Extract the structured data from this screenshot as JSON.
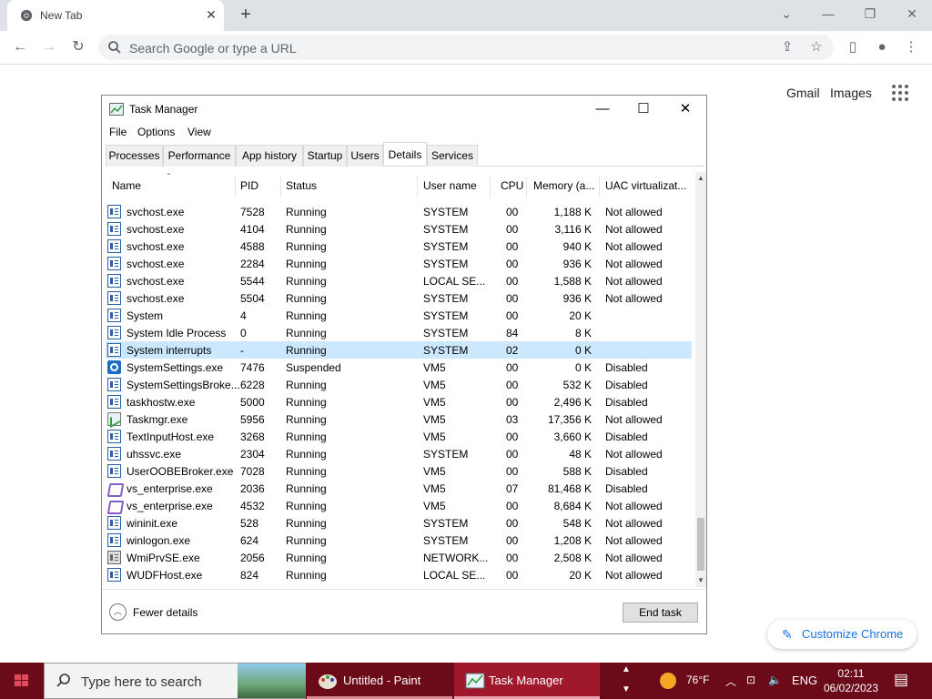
{
  "browser": {
    "tab_title": "New Tab",
    "omnibox_placeholder": "Search Google or type a URL",
    "links": {
      "gmail": "Gmail",
      "images": "Images"
    },
    "customize_label": "Customize Chrome"
  },
  "task_manager": {
    "title": "Task Manager",
    "menu": {
      "file": "File",
      "options": "Options",
      "view": "View"
    },
    "tabs": [
      "Processes",
      "Performance",
      "App history",
      "Startup",
      "Users",
      "Details",
      "Services"
    ],
    "active_tab": "Details",
    "columns": {
      "name": "Name",
      "pid": "PID",
      "status": "Status",
      "user": "User name",
      "cpu": "CPU",
      "memory": "Memory (a...",
      "uac": "UAC virtualizat..."
    },
    "rows": [
      {
        "icon": "window",
        "name": "svchost.exe",
        "pid": "7528",
        "status": "Running",
        "user": "SYSTEM",
        "cpu": "00",
        "mem": "1,188 K",
        "uac": "Not allowed"
      },
      {
        "icon": "window",
        "name": "svchost.exe",
        "pid": "4104",
        "status": "Running",
        "user": "SYSTEM",
        "cpu": "00",
        "mem": "3,116 K",
        "uac": "Not allowed"
      },
      {
        "icon": "window",
        "name": "svchost.exe",
        "pid": "4588",
        "status": "Running",
        "user": "SYSTEM",
        "cpu": "00",
        "mem": "940 K",
        "uac": "Not allowed"
      },
      {
        "icon": "window",
        "name": "svchost.exe",
        "pid": "2284",
        "status": "Running",
        "user": "SYSTEM",
        "cpu": "00",
        "mem": "936 K",
        "uac": "Not allowed"
      },
      {
        "icon": "window",
        "name": "svchost.exe",
        "pid": "5544",
        "status": "Running",
        "user": "LOCAL SE...",
        "cpu": "00",
        "mem": "1,588 K",
        "uac": "Not allowed"
      },
      {
        "icon": "window",
        "name": "svchost.exe",
        "pid": "5504",
        "status": "Running",
        "user": "SYSTEM",
        "cpu": "00",
        "mem": "936 K",
        "uac": "Not allowed"
      },
      {
        "icon": "window",
        "name": "System",
        "pid": "4",
        "status": "Running",
        "user": "SYSTEM",
        "cpu": "00",
        "mem": "20 K",
        "uac": ""
      },
      {
        "icon": "window",
        "name": "System Idle Process",
        "pid": "0",
        "status": "Running",
        "user": "SYSTEM",
        "cpu": "84",
        "mem": "8 K",
        "uac": ""
      },
      {
        "icon": "window",
        "name": "System interrupts",
        "pid": "-",
        "status": "Running",
        "user": "SYSTEM",
        "cpu": "02",
        "mem": "0 K",
        "uac": "",
        "selected": true
      },
      {
        "icon": "gear",
        "name": "SystemSettings.exe",
        "pid": "7476",
        "status": "Suspended",
        "user": "VM5",
        "cpu": "00",
        "mem": "0 K",
        "uac": "Disabled"
      },
      {
        "icon": "window",
        "name": "SystemSettingsBroke...",
        "pid": "6228",
        "status": "Running",
        "user": "VM5",
        "cpu": "00",
        "mem": "532 K",
        "uac": "Disabled"
      },
      {
        "icon": "window",
        "name": "taskhostw.exe",
        "pid": "5000",
        "status": "Running",
        "user": "VM5",
        "cpu": "00",
        "mem": "2,496 K",
        "uac": "Disabled"
      },
      {
        "icon": "taskmgr",
        "name": "Taskmgr.exe",
        "pid": "5956",
        "status": "Running",
        "user": "VM5",
        "cpu": "03",
        "mem": "17,356 K",
        "uac": "Not allowed"
      },
      {
        "icon": "window",
        "name": "TextInputHost.exe",
        "pid": "3268",
        "status": "Running",
        "user": "VM5",
        "cpu": "00",
        "mem": "3,660 K",
        "uac": "Disabled"
      },
      {
        "icon": "window",
        "name": "uhssvc.exe",
        "pid": "2304",
        "status": "Running",
        "user": "SYSTEM",
        "cpu": "00",
        "mem": "48 K",
        "uac": "Not allowed"
      },
      {
        "icon": "window",
        "name": "UserOOBEBroker.exe",
        "pid": "7028",
        "status": "Running",
        "user": "VM5",
        "cpu": "00",
        "mem": "588 K",
        "uac": "Disabled"
      },
      {
        "icon": "vs",
        "name": "vs_enterprise.exe",
        "pid": "2036",
        "status": "Running",
        "user": "VM5",
        "cpu": "07",
        "mem": "81,468 K",
        "uac": "Disabled"
      },
      {
        "icon": "vs",
        "name": "vs_enterprise.exe",
        "pid": "4532",
        "status": "Running",
        "user": "VM5",
        "cpu": "00",
        "mem": "8,684 K",
        "uac": "Not allowed"
      },
      {
        "icon": "window",
        "name": "wininit.exe",
        "pid": "528",
        "status": "Running",
        "user": "SYSTEM",
        "cpu": "00",
        "mem": "548 K",
        "uac": "Not allowed"
      },
      {
        "icon": "window",
        "name": "winlogon.exe",
        "pid": "624",
        "status": "Running",
        "user": "SYSTEM",
        "cpu": "00",
        "mem": "1,208 K",
        "uac": "Not allowed"
      },
      {
        "icon": "wmi",
        "name": "WmiPrvSE.exe",
        "pid": "2056",
        "status": "Running",
        "user": "NETWORK...",
        "cpu": "00",
        "mem": "2,508 K",
        "uac": "Not allowed"
      },
      {
        "icon": "window",
        "name": "WUDFHost.exe",
        "pid": "824",
        "status": "Running",
        "user": "LOCAL SE...",
        "cpu": "00",
        "mem": "20 K",
        "uac": "Not allowed"
      }
    ],
    "fewer_details": "Fewer details",
    "end_task": "End task"
  },
  "taskbar": {
    "search_placeholder": "Type here to search",
    "apps": {
      "paint": "Untitled - Paint",
      "taskmgr": "Task Manager"
    },
    "weather": "76°F",
    "language": "ENG",
    "time": "02:11",
    "date": "06/02/2023"
  }
}
